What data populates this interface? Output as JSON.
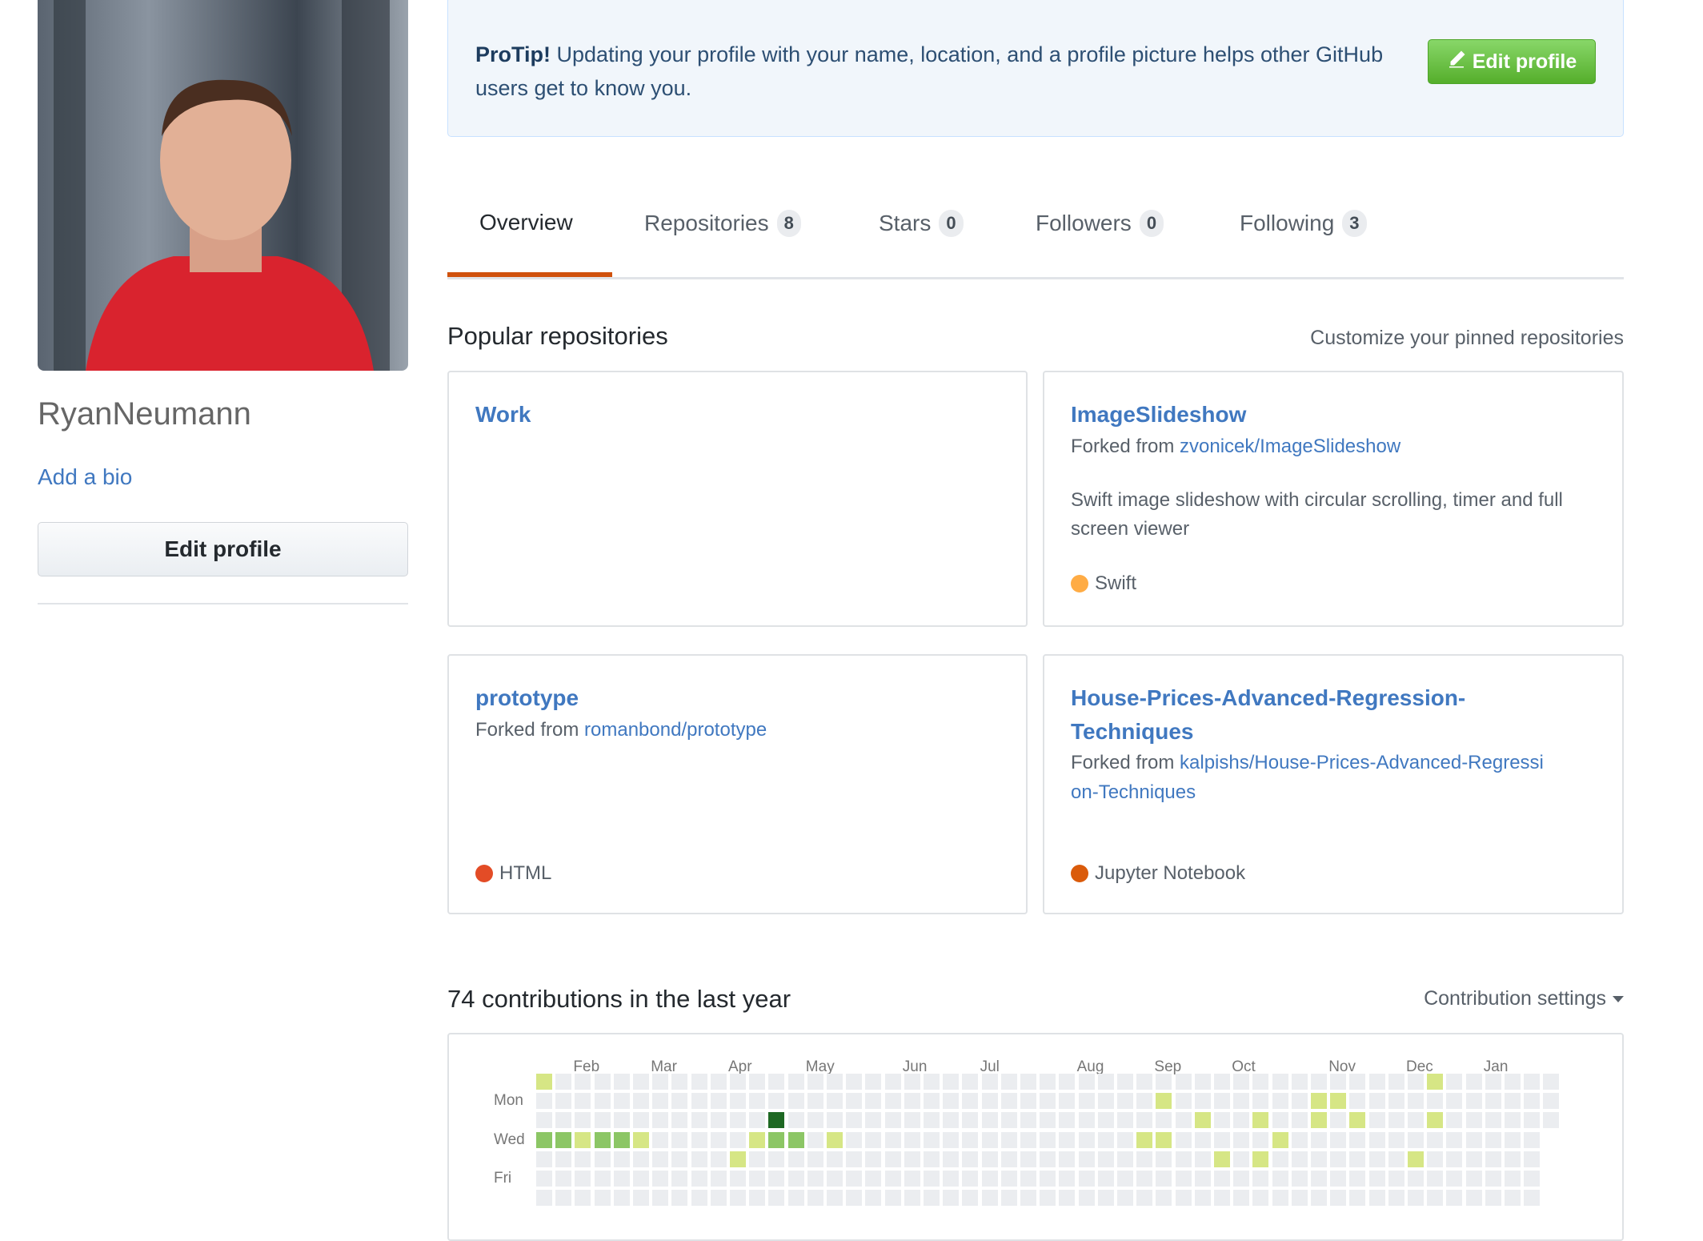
{
  "sidebar": {
    "username": "RyanNeumann",
    "add_bio": "Add a bio",
    "edit_profile": "Edit profile"
  },
  "protip": {
    "label": "ProTip!",
    "text": "Updating your profile with your name, location, and a profile picture helps other GitHub users get to know you.",
    "button": "Edit profile"
  },
  "tabs": [
    {
      "label": "Overview",
      "count": null
    },
    {
      "label": "Repositories",
      "count": "8"
    },
    {
      "label": "Stars",
      "count": "0"
    },
    {
      "label": "Followers",
      "count": "0"
    },
    {
      "label": "Following",
      "count": "3"
    }
  ],
  "popular": {
    "heading": "Popular repositories",
    "customize": "Customize your pinned repositories",
    "repos": [
      {
        "name": "Work"
      },
      {
        "name": "ImageSlideshow",
        "forked_prefix": "Forked from ",
        "forked_from": "zvonicek/ImageSlideshow",
        "description": "Swift image slideshow with circular scrolling, timer and full screen viewer",
        "language": "Swift",
        "lang_color": "#ffac45"
      },
      {
        "name": "prototype",
        "forked_prefix": "Forked from ",
        "forked_from": "romanbond/prototype",
        "language": "HTML",
        "lang_color": "#e34c26"
      },
      {
        "name": "House-Prices-Advanced-Regression-Techniques",
        "forked_prefix": "Forked from ",
        "forked_from": "kalpishs/House-Prices-Advanced-Regression-Techniques",
        "language": "Jupyter Notebook",
        "lang_color": "#da5b0b"
      }
    ]
  },
  "contributions": {
    "heading": "74 contributions in the last year",
    "settings": "Contribution settings"
  },
  "chart_data": {
    "type": "heatmap",
    "weeks": 53,
    "last_week_days": 3,
    "months": [
      {
        "label": "Feb",
        "week": 2
      },
      {
        "label": "Mar",
        "week": 6
      },
      {
        "label": "Apr",
        "week": 10
      },
      {
        "label": "May",
        "week": 14
      },
      {
        "label": "Jun",
        "week": 19
      },
      {
        "label": "Jul",
        "week": 23
      },
      {
        "label": "Aug",
        "week": 28
      },
      {
        "label": "Sep",
        "week": 32
      },
      {
        "label": "Oct",
        "week": 36
      },
      {
        "label": "Nov",
        "week": 41
      },
      {
        "label": "Dec",
        "week": 45
      },
      {
        "label": "Jan",
        "week": 49
      }
    ],
    "day_labels": [
      {
        "label": "Mon",
        "day": 1
      },
      {
        "label": "Wed",
        "day": 3
      },
      {
        "label": "Fri",
        "day": 5
      }
    ],
    "level_colors": [
      "#ebedf0",
      "#d6e685",
      "#8cc665",
      "#44a340",
      "#1e6823"
    ],
    "cells": [
      {
        "week": 0,
        "day": 0,
        "level": 1
      },
      {
        "week": 12,
        "day": 2,
        "level": 4
      },
      {
        "week": 0,
        "day": 3,
        "level": 2
      },
      {
        "week": 1,
        "day": 3,
        "level": 2
      },
      {
        "week": 2,
        "day": 3,
        "level": 1
      },
      {
        "week": 3,
        "day": 3,
        "level": 2
      },
      {
        "week": 4,
        "day": 3,
        "level": 2
      },
      {
        "week": 5,
        "day": 3,
        "level": 1
      },
      {
        "week": 11,
        "day": 3,
        "level": 1
      },
      {
        "week": 12,
        "day": 3,
        "level": 2
      },
      {
        "week": 13,
        "day": 3,
        "level": 2
      },
      {
        "week": 15,
        "day": 3,
        "level": 1
      },
      {
        "week": 10,
        "day": 4,
        "level": 1
      },
      {
        "week": 46,
        "day": 0,
        "level": 1
      },
      {
        "week": 32,
        "day": 1,
        "level": 1
      },
      {
        "week": 40,
        "day": 1,
        "level": 1
      },
      {
        "week": 41,
        "day": 1,
        "level": 1
      },
      {
        "week": 34,
        "day": 2,
        "level": 1
      },
      {
        "week": 37,
        "day": 2,
        "level": 1
      },
      {
        "week": 40,
        "day": 2,
        "level": 1
      },
      {
        "week": 42,
        "day": 2,
        "level": 1
      },
      {
        "week": 46,
        "day": 2,
        "level": 1
      },
      {
        "week": 31,
        "day": 3,
        "level": 1
      },
      {
        "week": 32,
        "day": 3,
        "level": 1
      },
      {
        "week": 38,
        "day": 3,
        "level": 1
      },
      {
        "week": 35,
        "day": 4,
        "level": 1
      },
      {
        "week": 37,
        "day": 4,
        "level": 1
      },
      {
        "week": 45,
        "day": 4,
        "level": 1
      }
    ]
  }
}
